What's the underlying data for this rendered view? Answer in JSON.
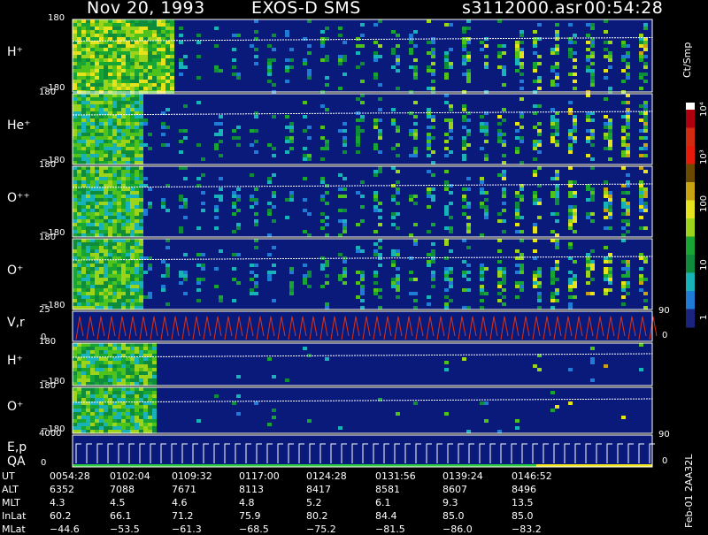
{
  "header": {
    "date": "Nov 20, 1993",
    "instrument": "EXOS-D SMS",
    "file": "s3112000.asr",
    "time": "00:54:28"
  },
  "colorbar": {
    "unit": "Ct/Smp",
    "labels": [
      "10⁴",
      "10³",
      "100",
      "10",
      "1"
    ]
  },
  "footer_id": "Feb-01 2AA32L",
  "chart_data": {
    "type": "heatmap",
    "panels": [
      {
        "label": "H⁺",
        "ylim": [
          -180,
          180
        ],
        "ticks": [
          "180",
          "−180"
        ]
      },
      {
        "label": "He⁺",
        "ylim": [
          -180,
          180
        ],
        "ticks": [
          "180",
          "−180"
        ]
      },
      {
        "label": "O⁺⁺",
        "ylim": [
          -180,
          180
        ],
        "ticks": [
          "180",
          "−180"
        ]
      },
      {
        "label": "O⁺",
        "ylim": [
          -180,
          180
        ],
        "ticks": [
          "180",
          "−180"
        ]
      },
      {
        "label": "V,r",
        "ylim": [
          0,
          25
        ],
        "ticks": [
          "25",
          "0"
        ],
        "right_ticks": [
          "90",
          "0"
        ]
      },
      {
        "label": "H⁺",
        "ylim": [
          -180,
          180
        ],
        "ticks": [
          "180",
          "−180"
        ]
      },
      {
        "label": "O⁺",
        "ylim": [
          -180,
          180
        ],
        "ticks": [
          "180",
          "−180"
        ]
      },
      {
        "label": "E,p\nQA",
        "ylim": [
          0,
          4000
        ],
        "ticks": [
          "4000",
          "0"
        ],
        "right_ticks": [
          "90",
          "0"
        ]
      }
    ],
    "ephemeris": {
      "rows": [
        {
          "name": "UT",
          "values": [
            "0054:28",
            "0102:04",
            "0109:32",
            "0117:00",
            "0124:28",
            "0131:56",
            "0139:24",
            "0146:52"
          ]
        },
        {
          "name": "ALT",
          "values": [
            "6352",
            "7088",
            "7671",
            "8113",
            "8417",
            "8581",
            "8607",
            "8496"
          ]
        },
        {
          "name": "MLT",
          "values": [
            "4.3",
            "4.5",
            "4.6",
            "4.8",
            "5.2",
            "6.1",
            "9.3",
            "13.5"
          ]
        },
        {
          "name": "InLat",
          "values": [
            "60.2",
            "66.1",
            "71.2",
            "75.9",
            "80.2",
            "84.4",
            "85.0",
            "85.0"
          ]
        },
        {
          "name": "MLat",
          "values": [
            "−44.6",
            "−53.5",
            "−61.3",
            "−68.5",
            "−75.2",
            "−81.5",
            "−86.0",
            "−83.2"
          ]
        }
      ]
    }
  }
}
